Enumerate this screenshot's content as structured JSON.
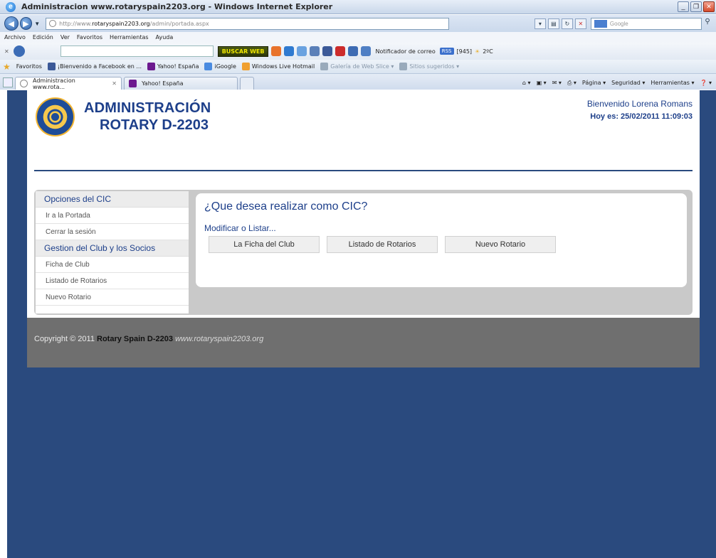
{
  "browser": {
    "window_title": "Administracion www.rotaryspain2203.org - Windows Internet Explorer",
    "url_prefix": "http://www.",
    "url_domain": "rotaryspain2203.org",
    "url_path": "/admin/portada.aspx",
    "search_placeholder": "Google",
    "menu": [
      "Archivo",
      "Edición",
      "Ver",
      "Favoritos",
      "Herramientas",
      "Ayuda"
    ],
    "toolbar": {
      "buscar_label": "BUSCAR WEB",
      "notificador_label": "Notificador de correo",
      "rss_label": "RSS",
      "rss_count": "[945]",
      "weather": "2ºC"
    },
    "favorites_label": "Favoritos",
    "favorites": [
      "¡Bienvenido a Facebook en ...",
      "Yahoo! España",
      "iGoogle",
      "Windows Live Hotmail",
      "Galería de Web Slice",
      "Sitios sugeridos"
    ],
    "tabs": [
      {
        "label": "Administracion www.rota...",
        "active": true
      },
      {
        "label": "Yahoo! España",
        "active": false
      }
    ],
    "command_bar": [
      "Página",
      "Seguridad",
      "Herramientas"
    ]
  },
  "header": {
    "brand_line1": "ADMINISTRACIÓN",
    "brand_line2": "ROTARY D-2203",
    "welcome": "Bienvenido Lorena Romans",
    "date": "Hoy es: 25/02/2011 11:09:03"
  },
  "sidebar": {
    "sections": [
      {
        "title": "Opciones del CIC",
        "items": [
          "Ir a la Portada",
          "Cerrar la sesión"
        ]
      },
      {
        "title": "Gestion del Club y los Socios",
        "items": [
          "Ficha de Club",
          "Listado de Rotarios",
          "Nuevo Rotario"
        ]
      }
    ]
  },
  "main": {
    "question": "¿Que desea realizar como CIC?",
    "subtitle": "Modificar o Listar...",
    "buttons": [
      "La Ficha del Club",
      "Listado de Rotarios",
      "Nuevo Rotario"
    ]
  },
  "footer": {
    "copyright": "Copyright © 2011",
    "org": "Rotary Spain D-2203",
    "site": "www.rotaryspain2203.org"
  },
  "colors": {
    "brand_blue": "#1d3f8a",
    "page_bg": "#2a4a7e",
    "footer_bg": "#6f6f6f"
  }
}
